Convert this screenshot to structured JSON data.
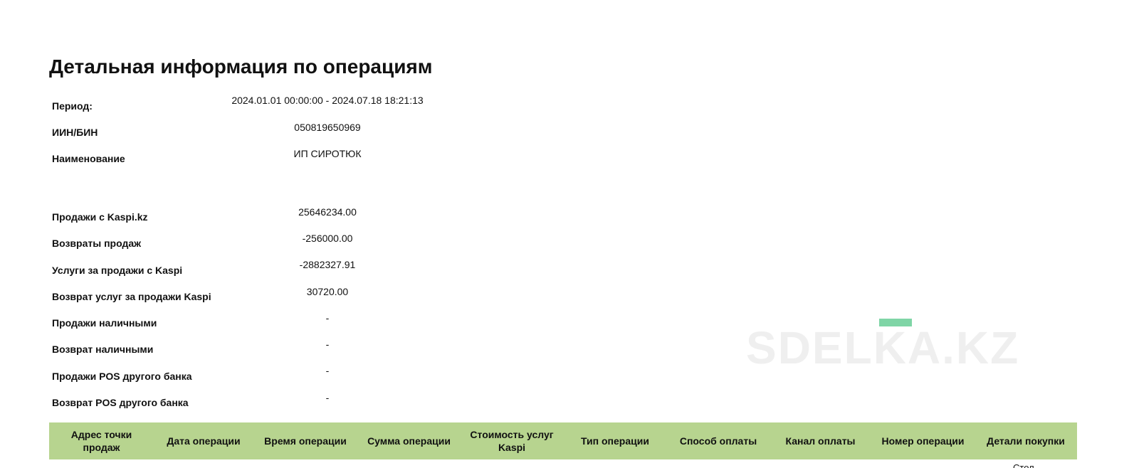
{
  "document": {
    "title": "Детальная информация по операциям"
  },
  "info_rows": [
    {
      "label": "Период:",
      "value": "2024.01.01 00:00:00 - 2024.07.18 18:21:13"
    },
    {
      "label": "ИИН/БИН",
      "value": "050819650969"
    },
    {
      "label": "Наименование",
      "value": "ИП СИРОТЮК"
    }
  ],
  "summary_rows": [
    {
      "label": "Продажи с Kaspi.kz",
      "value": "25646234.00"
    },
    {
      "label": "Возвраты продаж",
      "value": "-256000.00"
    },
    {
      "label": "Услуги за продажи с Kaspi",
      "value": "-2882327.91"
    },
    {
      "label": "Возврат услуг за продажи Kaspi",
      "value": "30720.00"
    },
    {
      "label": "Продажи наличными",
      "value": "-"
    },
    {
      "label": "Возврат наличными",
      "value": "-"
    },
    {
      "label": "Продажи POS другого банка",
      "value": "-"
    },
    {
      "label": "Возврат POS другого банка",
      "value": "-"
    }
  ],
  "table": {
    "header_color": "#b7d48f",
    "columns": [
      "Адрес точки продаж",
      "Дата операции",
      "Время операции",
      "Сумма операции",
      "Стоимость услуг Kaspi",
      "Тип операции",
      "Способ оплаты",
      "Канал оплаты",
      "Номер операции",
      "Детали покупки"
    ],
    "first_row_partial": "Стол"
  },
  "watermark": {
    "text": "SDELKA.KZ"
  }
}
